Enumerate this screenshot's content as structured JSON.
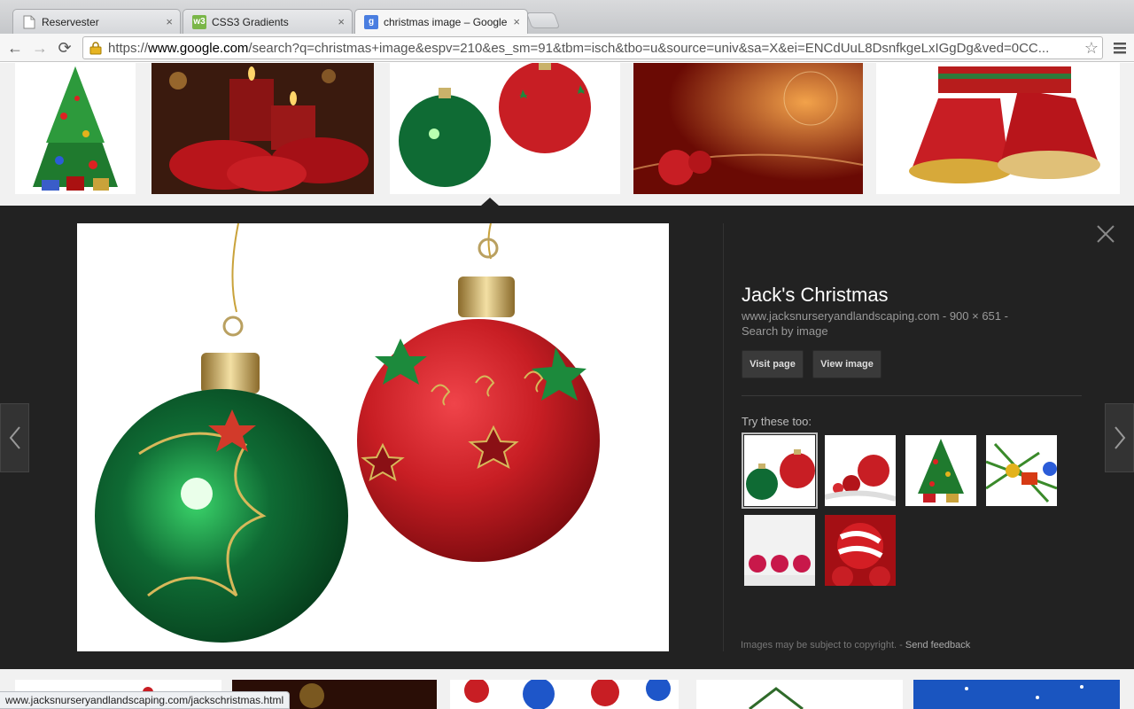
{
  "tabs": [
    {
      "title": "Reservester",
      "close": "×"
    },
    {
      "title": "CSS3 Gradients",
      "favicon_text": "w3",
      "close": "×"
    },
    {
      "title": "christmas image – Google",
      "favicon_text": "g",
      "close": "×"
    }
  ],
  "toolbar": {
    "back_icon": "←",
    "forward_icon": "→",
    "reload_icon": "⟳",
    "star_icon": "☆",
    "url_prefix": "https://",
    "url_host": "www.google.com",
    "url_rest": "/search?q=christmas+image&espv=210&es_sm=91&tbm=isch&tbo=u&source=univ&sa=X&ei=ENCdUuL8DsnfkgeLxIGgDg&ved=0CC..."
  },
  "detail": {
    "title": "Jack's Christmas",
    "source": "www.jacksnurseryandlandscaping.com - 900 × 651 -",
    "search_by_image": "Search by image",
    "visit_page": "Visit page",
    "view_image": "View image",
    "try_these": "Try these too:",
    "copyright": "Images may be subject to copyright.",
    "sep": " - ",
    "feedback": "Send feedback"
  },
  "status_url": "www.jacksnurseryandlandscaping.com/jackschristmas.html",
  "colors": {
    "panel_bg": "#222222",
    "ornament_red": "#c81e24",
    "ornament_green": "#0f6b34"
  }
}
